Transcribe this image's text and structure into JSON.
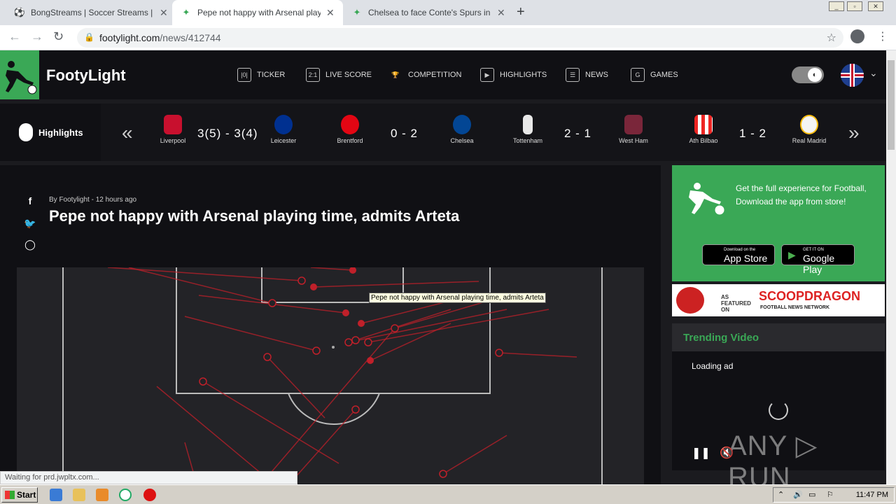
{
  "browser": {
    "tabs": [
      {
        "title": "BongStreams | Soccer Streams | NBA"
      },
      {
        "title": "Pepe not happy with Arsenal playing"
      },
      {
        "title": "Chelsea to face Conte's Spurs in EFL"
      }
    ],
    "url_domain": "footylight.com",
    "url_path": "/news/412744",
    "status": "Waiting for prd.jwpltx.com..."
  },
  "site": {
    "brand": "FootyLight",
    "nav": [
      {
        "label": "TICKER",
        "icon": "ticker-icon",
        "glyph": "|0|"
      },
      {
        "label": "LIVE SCORE",
        "icon": "live-score-icon",
        "glyph": "2:1"
      },
      {
        "label": "COMPETITION",
        "icon": "trophy-icon",
        "glyph": "🏆"
      },
      {
        "label": "HIGHLIGHTS",
        "icon": "play-icon",
        "glyph": "▶"
      },
      {
        "label": "NEWS",
        "icon": "news-icon",
        "glyph": "☰"
      },
      {
        "label": "GAMES",
        "icon": "games-icon",
        "glyph": "G"
      }
    ]
  },
  "highlights": {
    "label": "Highlights",
    "matches": [
      {
        "home": "Liverpool",
        "away": "Leicester",
        "score": "3(5) - 3(4)",
        "home_color": "#c8102e",
        "away_color": "#003090"
      },
      {
        "home": "Brentford",
        "away": "Chelsea",
        "score": "0 - 2",
        "home_color": "#e30613",
        "away_color": "#034694"
      },
      {
        "home": "Tottenham",
        "away": "West Ham",
        "score": "2 - 1",
        "home_color": "#ffffff",
        "away_color": "#7a263a"
      },
      {
        "home": "Ath Bilbao",
        "away": "Real Madrid",
        "score": "1 - 2",
        "home_color": "#ee2523",
        "away_color": "#febe10"
      }
    ]
  },
  "article": {
    "byline": "By Footylight - 12 hours ago",
    "headline": "Pepe not happy with Arsenal playing time, admits Arteta",
    "tooltip": "Pepe not happy with Arsenal playing time, admits Arteta"
  },
  "sidebar": {
    "promo_text": "Get the full experience for Football, Download the app from store!",
    "app_store_small": "Download on the",
    "app_store_big": "App Store",
    "play_small": "GET IT ON",
    "play_big": "Google Play",
    "banner_as": "AS",
    "banner_featured": "FEATURED",
    "banner_on": "ON",
    "banner_name": "SCOOPDRAGON",
    "banner_sub": "FOOTBALL NEWS NETWORK",
    "trending_title": "Trending Video",
    "loading": "Loading ad",
    "watermark": "ANY ▷ RUN"
  },
  "taskbar": {
    "start": "Start",
    "clock": "11:47 PM"
  }
}
